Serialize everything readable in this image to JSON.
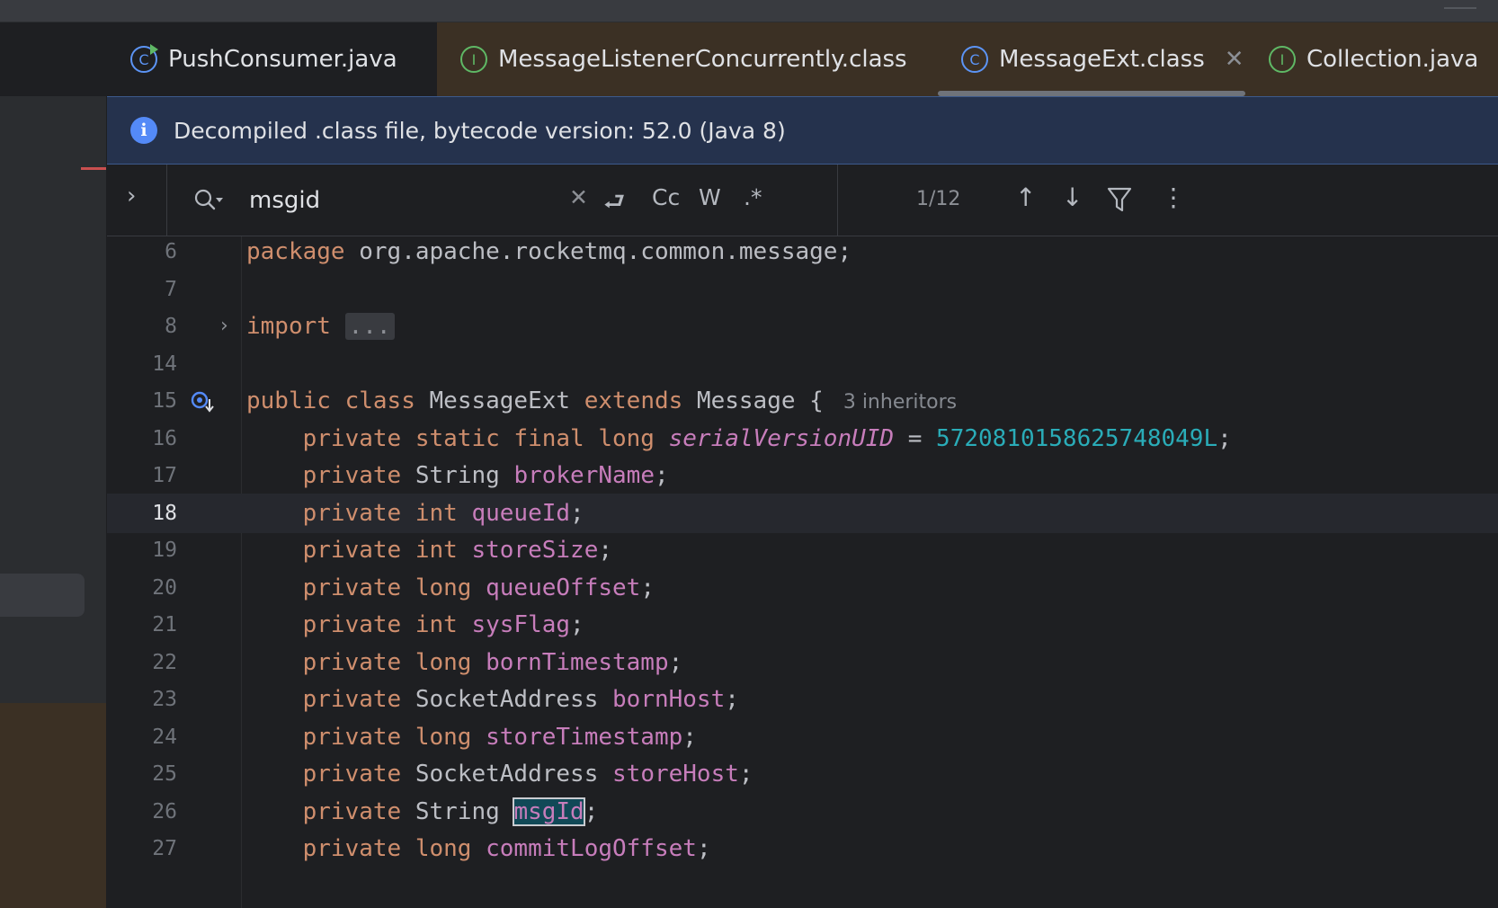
{
  "tabs": [
    {
      "label": "PushConsumer.java",
      "icon": "class-run-icon",
      "glyph": "C"
    },
    {
      "label": "MessageListenerConcurrently.class",
      "icon": "interface-icon",
      "glyph": "I"
    },
    {
      "label": "MessageExt.class",
      "icon": "class-icon",
      "glyph": "C",
      "active": true,
      "close": "✕"
    },
    {
      "label": "Collection.java",
      "icon": "interface-icon",
      "glyph": "I"
    }
  ],
  "banner": {
    "icon": "info-icon",
    "glyph": "i",
    "text": "Decompiled .class file, bytecode version: 52.0 (Java 8)"
  },
  "find": {
    "query": "msgid",
    "clear": "✕",
    "options": {
      "wrap": "⮐",
      "match_case": "Cc",
      "words": "W",
      "regex": ".*"
    },
    "count": "1/12",
    "prev": "↑",
    "next": "↓",
    "filter": "⏷",
    "more": "⋮"
  },
  "editor": {
    "current_line": "18",
    "lines": [
      {
        "n": "6",
        "parts": [
          [
            "kw",
            "package"
          ],
          [
            "t",
            " org.apache.rocketmq.common.message;"
          ]
        ]
      },
      {
        "n": "7",
        "parts": []
      },
      {
        "n": "8",
        "fold": "›",
        "parts": [
          [
            "kw",
            "import"
          ],
          [
            "t",
            " "
          ],
          [
            "chip",
            "..."
          ]
        ]
      },
      {
        "n": "14",
        "parts": []
      },
      {
        "n": "15",
        "gutter_icon": "implemented-down-icon",
        "parts": [
          [
            "kw",
            "public"
          ],
          [
            "t",
            " "
          ],
          [
            "kw",
            "class"
          ],
          [
            "t",
            " MessageExt "
          ],
          [
            "kw",
            "extends"
          ],
          [
            "t",
            " Message {"
          ],
          [
            "hint",
            "3 inheritors"
          ]
        ]
      },
      {
        "n": "16",
        "parts": [
          [
            "t",
            "    "
          ],
          [
            "kw",
            "private static final long"
          ],
          [
            "t",
            " "
          ],
          [
            "sfld",
            "serialVersionUID"
          ],
          [
            "t",
            " = "
          ],
          [
            "num",
            "5720810158625748049L"
          ],
          [
            "t",
            ";"
          ]
        ]
      },
      {
        "n": "17",
        "parts": [
          [
            "t",
            "    "
          ],
          [
            "kw",
            "private"
          ],
          [
            "t",
            " String "
          ],
          [
            "fld",
            "brokerName"
          ],
          [
            "t",
            ";"
          ]
        ]
      },
      {
        "n": "18",
        "parts": [
          [
            "t",
            "    "
          ],
          [
            "kw",
            "private int"
          ],
          [
            "t",
            " "
          ],
          [
            "fld",
            "queueId"
          ],
          [
            "t",
            ";"
          ]
        ]
      },
      {
        "n": "19",
        "parts": [
          [
            "t",
            "    "
          ],
          [
            "kw",
            "private int"
          ],
          [
            "t",
            " "
          ],
          [
            "fld",
            "storeSize"
          ],
          [
            "t",
            ";"
          ]
        ]
      },
      {
        "n": "20",
        "parts": [
          [
            "t",
            "    "
          ],
          [
            "kw",
            "private long"
          ],
          [
            "t",
            " "
          ],
          [
            "fld",
            "queueOffset"
          ],
          [
            "t",
            ";"
          ]
        ]
      },
      {
        "n": "21",
        "parts": [
          [
            "t",
            "    "
          ],
          [
            "kw",
            "private int"
          ],
          [
            "t",
            " "
          ],
          [
            "fld",
            "sysFlag"
          ],
          [
            "t",
            ";"
          ]
        ]
      },
      {
        "n": "22",
        "parts": [
          [
            "t",
            "    "
          ],
          [
            "kw",
            "private long"
          ],
          [
            "t",
            " "
          ],
          [
            "fld",
            "bornTimestamp"
          ],
          [
            "t",
            ";"
          ]
        ]
      },
      {
        "n": "23",
        "parts": [
          [
            "t",
            "    "
          ],
          [
            "kw",
            "private"
          ],
          [
            "t",
            " SocketAddress "
          ],
          [
            "fld",
            "bornHost"
          ],
          [
            "t",
            ";"
          ]
        ]
      },
      {
        "n": "24",
        "parts": [
          [
            "t",
            "    "
          ],
          [
            "kw",
            "private long"
          ],
          [
            "t",
            " "
          ],
          [
            "fld",
            "storeTimestamp"
          ],
          [
            "t",
            ";"
          ]
        ]
      },
      {
        "n": "25",
        "parts": [
          [
            "t",
            "    "
          ],
          [
            "kw",
            "private"
          ],
          [
            "t",
            " SocketAddress "
          ],
          [
            "fld",
            "storeHost"
          ],
          [
            "t",
            ";"
          ]
        ]
      },
      {
        "n": "26",
        "parts": [
          [
            "t",
            "    "
          ],
          [
            "kw",
            "private"
          ],
          [
            "t",
            " String "
          ],
          [
            "hl",
            "msgId"
          ],
          [
            "t",
            ";"
          ]
        ]
      },
      {
        "n": "27",
        "parts": [
          [
            "t",
            "    "
          ],
          [
            "kw",
            "private long"
          ],
          [
            "t",
            " "
          ],
          [
            "fld",
            "commitLogOffset"
          ],
          [
            "t",
            ";"
          ]
        ]
      }
    ]
  },
  "colors": {
    "keyword": "#cf8e6d",
    "field": "#c77dbb",
    "number": "#2aacb8",
    "text": "#bcbec4",
    "accent": "#548af7"
  }
}
